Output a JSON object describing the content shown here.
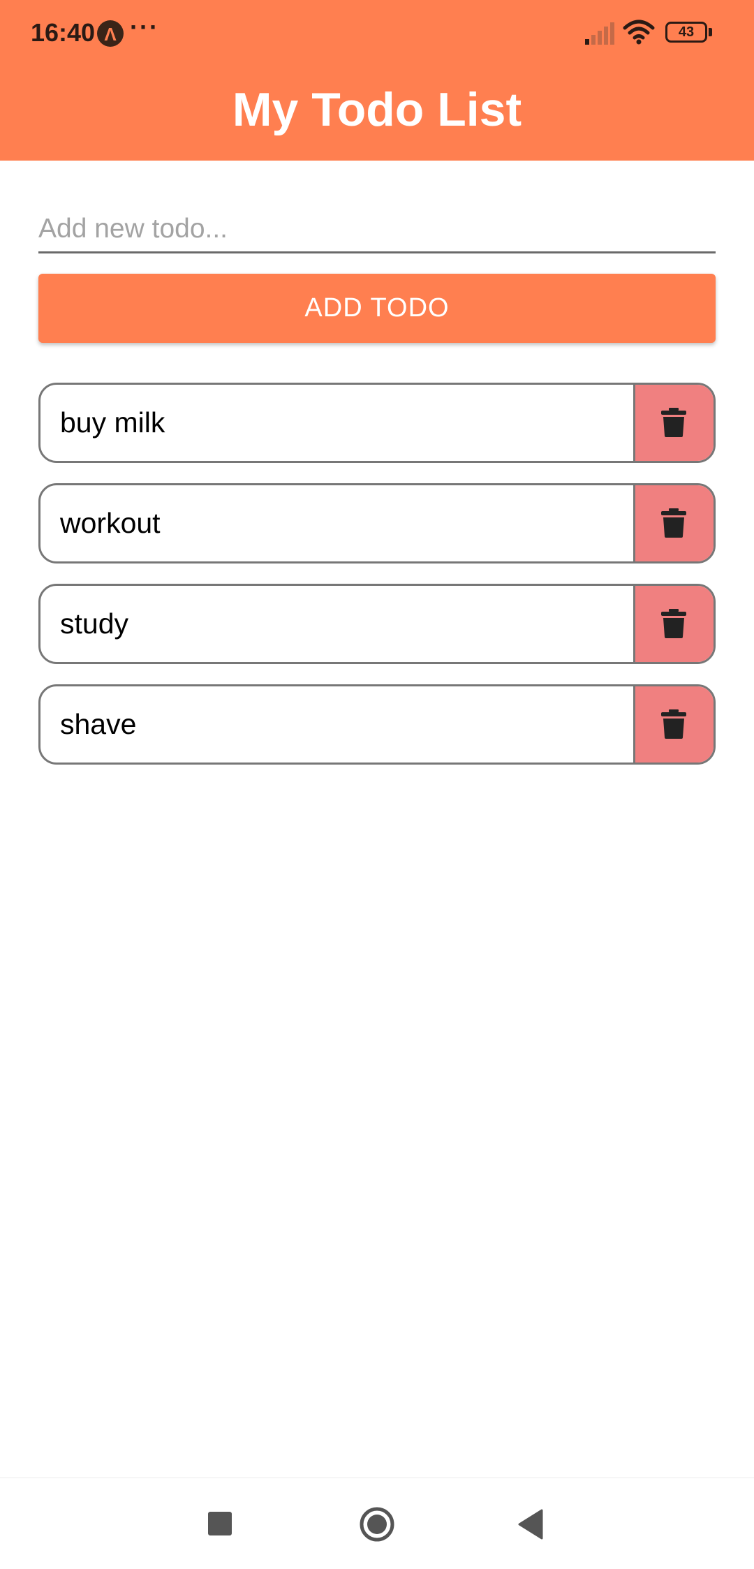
{
  "status_bar": {
    "time": "16:40",
    "app_icon_glyph": "Λ",
    "overflow": "···",
    "battery": "43",
    "icons": [
      "signal-icon",
      "wifi-icon",
      "battery-icon"
    ]
  },
  "header": {
    "title": "My Todo List",
    "background_color": "#FF7F50"
  },
  "input": {
    "value": "",
    "placeholder": "Add new todo..."
  },
  "add_button": {
    "label": "ADD TODO",
    "color": "#FF7F50"
  },
  "todos": [
    {
      "text": "buy milk"
    },
    {
      "text": "workout"
    },
    {
      "text": "study"
    },
    {
      "text": "shave"
    }
  ],
  "delete_button": {
    "icon": "trash-icon",
    "color": "#F08080"
  },
  "nav_bar": {
    "icons": [
      "recents-icon",
      "home-icon",
      "back-icon"
    ]
  }
}
